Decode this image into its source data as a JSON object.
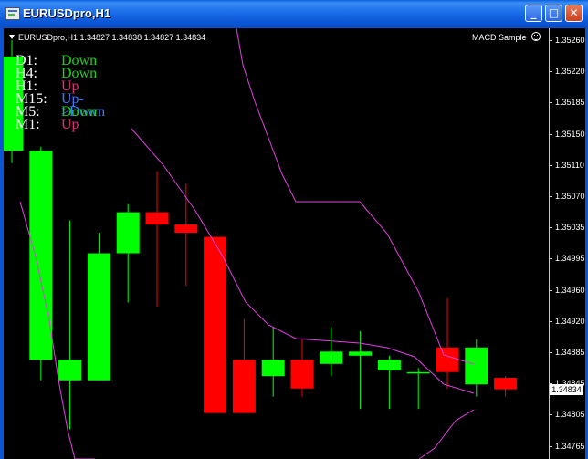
{
  "window": {
    "title": "EURUSDpro,H1",
    "buttons": [
      {
        "name": "minimize-button",
        "glyph": "_"
      },
      {
        "name": "maximize-button",
        "glyph": "□"
      },
      {
        "name": "close-button",
        "glyph": "✕"
      }
    ]
  },
  "chart": {
    "info_line": "EURUSDpro,H1  1.34827 1.34838 1.34827 1.34834",
    "expert_name": "MACD Sample",
    "current_price": "1.34834",
    "price_axis": [
      "1.35260",
      "1.35220",
      "1.35185",
      "1.35150",
      "1.35110",
      "1.35070",
      "1.35035",
      "1.34995",
      "1.34960",
      "1.34920",
      "1.34885",
      "1.34845",
      "1.34805",
      "1.34765"
    ],
    "colors": {
      "bull": "#00ff00",
      "bear": "#ff0000",
      "envelope": "#e040e0",
      "down": "#19d219",
      "up": "#e0307a",
      "updown": "#3a7bff"
    }
  },
  "trends": [
    {
      "tf": "D1:",
      "status": "Down",
      "kind": "down"
    },
    {
      "tf": "H4:",
      "status": "Down",
      "kind": "down"
    },
    {
      "tf": "H1:",
      "status": "Up",
      "kind": "up"
    },
    {
      "tf": "M15:",
      "status": "Up->Down",
      "kind": "updown"
    },
    {
      "tf": "M5:",
      "status": "Down",
      "kind": "down"
    },
    {
      "tf": "M1:",
      "status": "Up",
      "kind": "up"
    }
  ],
  "candles": [
    {
      "o": 1.35125,
      "h": 1.3526,
      "l": 1.3511,
      "c": 1.3524
    },
    {
      "o": 1.3487,
      "h": 1.3513,
      "l": 1.34845,
      "c": 1.35125
    },
    {
      "o": 1.34845,
      "h": 1.3504,
      "l": 1.34785,
      "c": 1.3487
    },
    {
      "o": 1.34845,
      "h": 1.35025,
      "l": 1.34845,
      "c": 1.35
    },
    {
      "o": 1.35,
      "h": 1.3506,
      "l": 1.3494,
      "c": 1.3505
    },
    {
      "o": 1.3505,
      "h": 1.351,
      "l": 1.34935,
      "c": 1.35035
    },
    {
      "o": 1.35035,
      "h": 1.35085,
      "l": 1.3496,
      "c": 1.35025
    },
    {
      "o": 1.3502,
      "h": 1.3503,
      "l": 1.34805,
      "c": 1.34805
    },
    {
      "o": 1.3487,
      "h": 1.3492,
      "l": 1.34805,
      "c": 1.34805
    },
    {
      "o": 1.3485,
      "h": 1.3491,
      "l": 1.34825,
      "c": 1.3487
    },
    {
      "o": 1.3487,
      "h": 1.34895,
      "l": 1.34825,
      "c": 1.34835
    },
    {
      "o": 1.34865,
      "h": 1.3491,
      "l": 1.3485,
      "c": 1.3488
    },
    {
      "o": 1.34875,
      "h": 1.34905,
      "l": 1.3481,
      "c": 1.3488
    },
    {
      "o": 1.34857,
      "h": 1.34875,
      "l": 1.3481,
      "c": 1.3487
    },
    {
      "o": 1.34855,
      "h": 1.3486,
      "l": 1.3481,
      "c": 1.34855
    },
    {
      "o": 1.34885,
      "h": 1.34945,
      "l": 1.34835,
      "c": 1.34855
    },
    {
      "o": 1.3484,
      "h": 1.34895,
      "l": 1.34825,
      "c": 1.34885
    },
    {
      "o": 1.34848,
      "h": 1.3485,
      "l": 1.34825,
      "c": 1.34834
    }
  ]
}
